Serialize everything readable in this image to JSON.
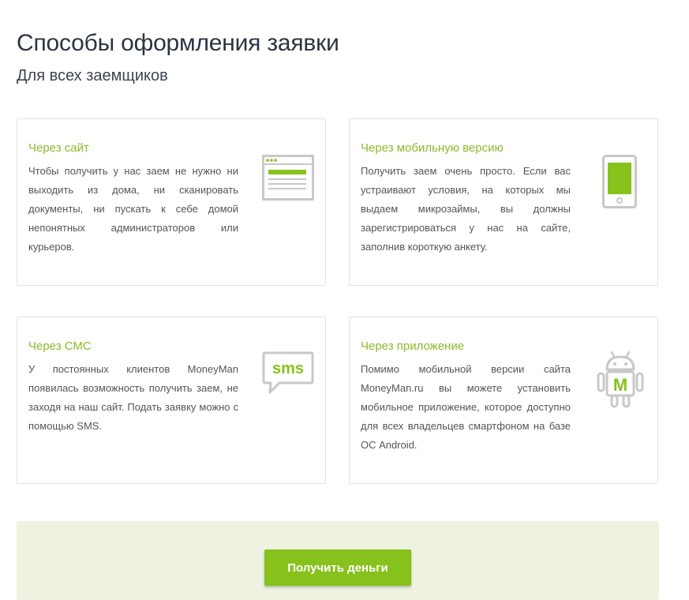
{
  "page": {
    "title": "Способы оформления заявки",
    "subtitle": "Для всех заемщиков"
  },
  "methods": [
    {
      "title": "Через сайт",
      "text": "Чтобы получить у нас заем не нужно ни выходить из дома, ни сканировать документы, ни пускать к себе домой непонятных администраторов или курьеров.",
      "icon": "browser-window-icon"
    },
    {
      "title": "Через мобильную версию",
      "text": "Получить заем очень просто. Если вас устраивают условия, на которых мы выдаем микрозаймы, вы должны зарегистрироваться у нас на сайте, заполнив короткую анкету.",
      "icon": "smartphone-icon"
    },
    {
      "title": "Через СМС",
      "text": "У постоянных клиентов MoneyMan появилась возможность получить заем, не заходя на наш сайт. Подать заявку можно с помощью SMS.",
      "icon": "sms-bubble-icon",
      "icon_text": "sms"
    },
    {
      "title": "Через приложение",
      "text": "Помимо мобильной версии сайта MoneyMan.ru вы можете установить мобильное приложение, которое доступно для всех владельцев смартфоном на базе ОС Android.",
      "icon": "android-app-icon",
      "icon_text": "M"
    }
  ],
  "cta": {
    "button_label": "Получить деньги"
  },
  "colors": {
    "accent": "#8bbb2a",
    "button": "#86c21b",
    "cta_background": "#eef3e1",
    "icon_gray": "#c8c8c8"
  }
}
